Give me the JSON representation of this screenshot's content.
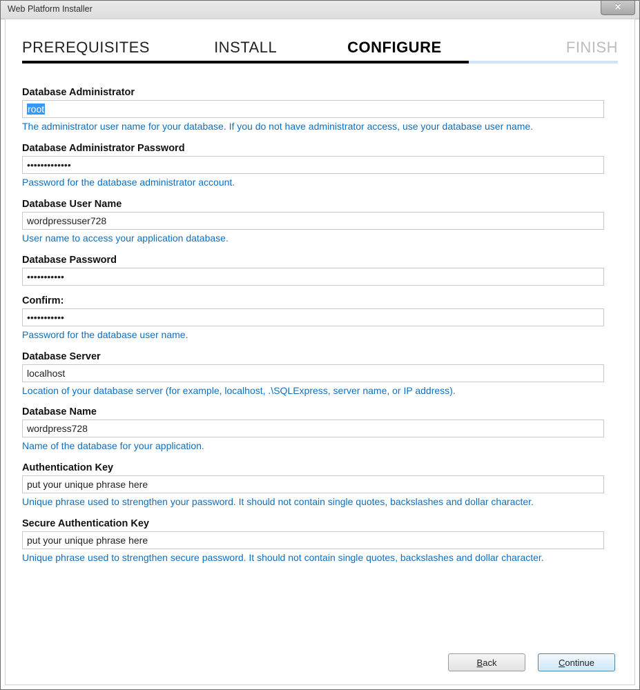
{
  "window": {
    "title": "Web Platform Installer"
  },
  "steps": {
    "items": [
      {
        "label": "PREREQUISITES",
        "state": "done"
      },
      {
        "label": "INSTALL",
        "state": "done"
      },
      {
        "label": "CONFIGURE",
        "state": "current"
      },
      {
        "label": "FINISH",
        "state": "future"
      }
    ]
  },
  "fields": {
    "dbAdmin": {
      "label": "Database Administrator",
      "value": "root",
      "help": "The administrator user name for your database. If you do not have administrator access, use your database user name."
    },
    "dbAdminPwd": {
      "label": "Database Administrator Password",
      "value": "•••••••••••••",
      "help": "Password for the database administrator account."
    },
    "dbUser": {
      "label": "Database User Name",
      "value": "wordpressuser728",
      "help": "User name to access your application database."
    },
    "dbPwd": {
      "label": "Database Password",
      "value": "•••••••••••"
    },
    "dbPwdConfirm": {
      "label": "Confirm:",
      "value": "•••••••••••",
      "help": "Password for the database user name."
    },
    "dbServer": {
      "label": "Database Server",
      "value": "localhost",
      "help": "Location of your database server (for example, localhost, .\\SQLExpress, server name, or IP address)."
    },
    "dbName": {
      "label": "Database Name",
      "value": "wordpress728",
      "help": "Name of the database for your application."
    },
    "authKey": {
      "label": "Authentication Key",
      "value": "put your unique phrase here",
      "help": "Unique phrase used to strengthen your password. It should not contain single quotes, backslashes and dollar character."
    },
    "secureAuthKey": {
      "label": "Secure Authentication Key",
      "value": "put your unique phrase here",
      "help": "Unique phrase used to strengthen secure password. It should not contain single quotes, backslashes and dollar character."
    }
  },
  "footer": {
    "back": "Back",
    "continue": "Continue"
  }
}
